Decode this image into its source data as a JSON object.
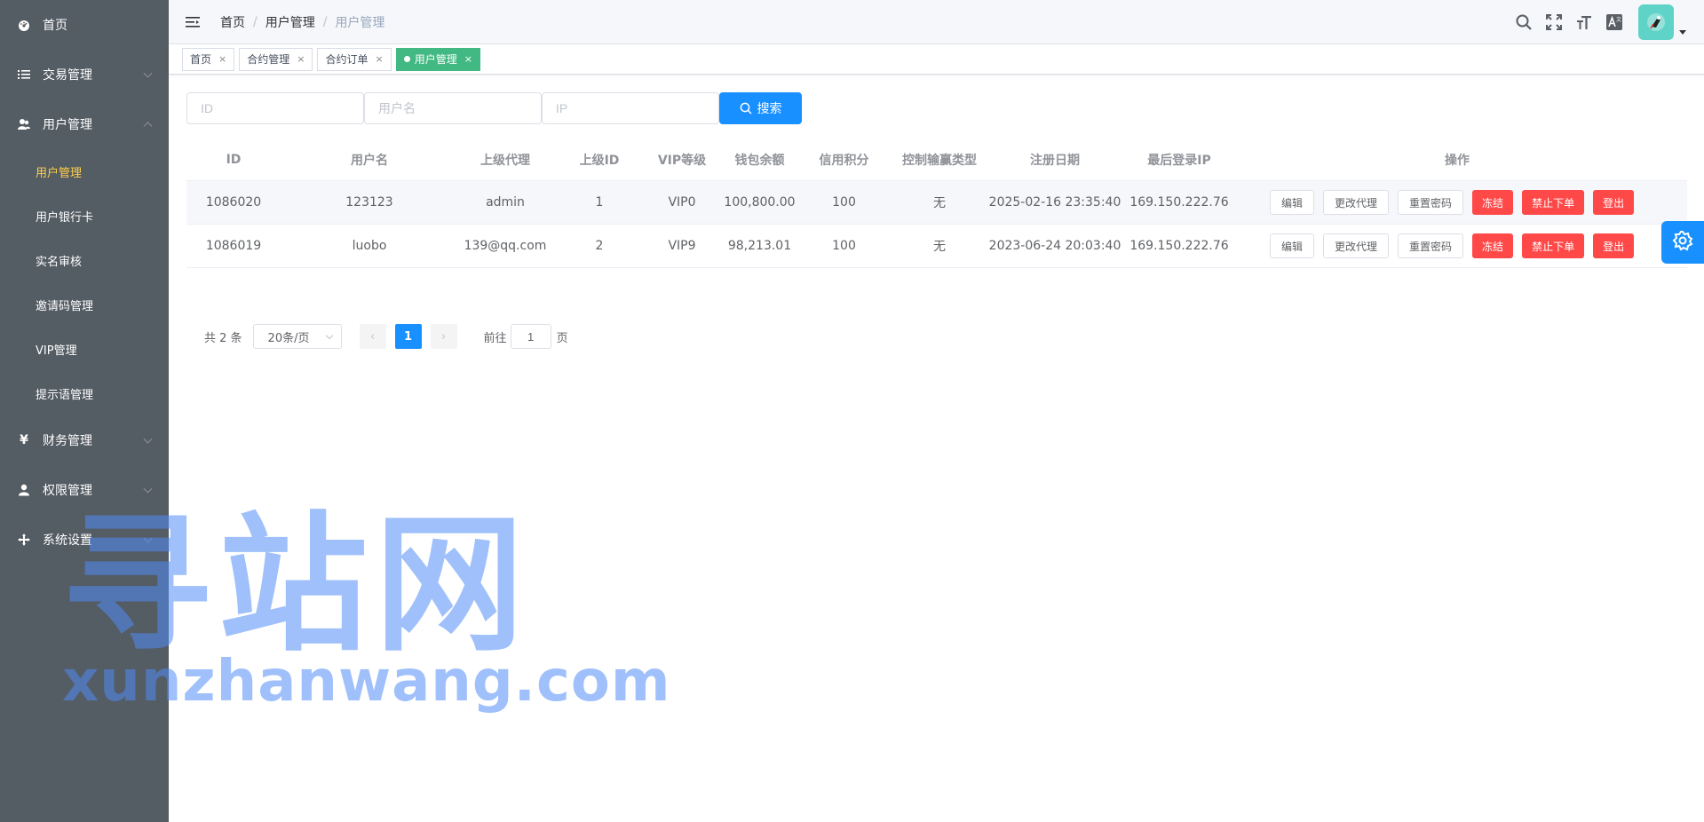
{
  "sidebar": {
    "items": [
      {
        "label": "首页",
        "icon": "dashboard-icon",
        "expandable": false
      },
      {
        "label": "交易管理",
        "icon": "list-icon",
        "expandable": true
      },
      {
        "label": "用户管理",
        "icon": "users-icon",
        "expandable": true,
        "expanded": true,
        "children": [
          "用户管理",
          "用户银行卡",
          "实名审核",
          "邀请码管理",
          "VIP管理",
          "提示语管理"
        ]
      },
      {
        "label": "财务管理",
        "icon": "yen-icon",
        "expandable": true
      },
      {
        "label": "权限管理",
        "icon": "user-icon",
        "expandable": true
      },
      {
        "label": "系统设置",
        "icon": "move-icon",
        "expandable": true
      }
    ],
    "active_child": "用户管理"
  },
  "header": {
    "breadcrumb": [
      "首页",
      "用户管理",
      "用户管理"
    ],
    "icons": [
      "search-icon",
      "fullscreen-icon",
      "font-size-icon",
      "translate-icon"
    ],
    "avatar": "avatar"
  },
  "tags": [
    {
      "label": "首页",
      "active": false
    },
    {
      "label": "合约管理",
      "active": false
    },
    {
      "label": "合约订单",
      "active": false
    },
    {
      "label": "用户管理",
      "active": true
    }
  ],
  "filters": {
    "id_placeholder": "ID",
    "username_placeholder": "用户名",
    "ip_placeholder": "IP",
    "search_label": "搜索"
  },
  "table": {
    "columns": [
      "ID",
      "用户名",
      "上级代理",
      "上级ID",
      "VIP等级",
      "钱包余额",
      "信用积分",
      "控制输赢类型",
      "注册日期",
      "最后登录IP",
      "操作"
    ],
    "rows": [
      {
        "id": "1086020",
        "username": "123123",
        "agent": "admin",
        "agent_id": "1",
        "vip": "VIP0",
        "balance": "100,800.00",
        "credit": "100",
        "control": "无",
        "reg_date": "2025-02-16 23:35:40",
        "last_ip": "169.150.222.76"
      },
      {
        "id": "1086019",
        "username": "luobo",
        "agent": "139@qq.com",
        "agent_id": "2",
        "vip": "VIP9",
        "balance": "98,213.01",
        "credit": "100",
        "control": "无",
        "reg_date": "2023-06-24 20:03:40",
        "last_ip": "169.150.222.76"
      }
    ],
    "actions": {
      "edit": "编辑",
      "change_agent": "更改代理",
      "reset_pwd": "重置密码",
      "freeze": "冻结",
      "ban_order": "禁止下单",
      "logout": "登出"
    }
  },
  "pagination": {
    "total_text": "共 2 条",
    "page_size": "20条/页",
    "current_page": "1",
    "goto_prefix": "前往",
    "goto_value": "1",
    "goto_suffix": "页"
  },
  "watermark": {
    "big": "寻站网",
    "small": "xunzhanwang.com"
  },
  "colors": {
    "sidebar_bg": "#545c64",
    "active_menu": "#ffd04b",
    "primary": "#1890ff",
    "tag_active": "#42b983",
    "danger": "#ff4949"
  }
}
